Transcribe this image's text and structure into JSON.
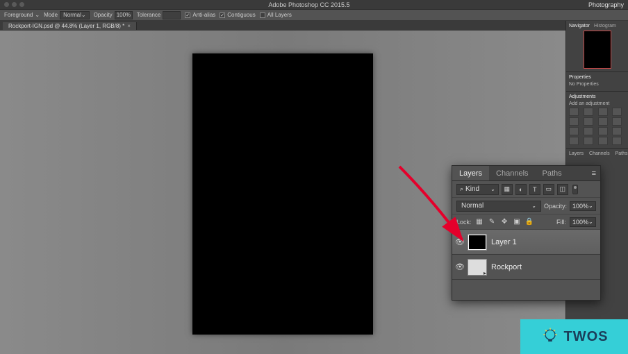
{
  "app": {
    "title": "Adobe Photoshop CC 2015.5",
    "workspace": "Photography"
  },
  "options": {
    "foreground_label": "Foreground",
    "mode_label": "Mode",
    "mode_value": "Normal",
    "opacity_label": "Opacity",
    "opacity_value": "100%",
    "tolerance_label": "Tolerance",
    "antialias_label": "Anti-alias",
    "contiguous_label": "Contiguous",
    "alllayers_label": "All Layers"
  },
  "tab": {
    "title": "Rockport-IGN.psd @ 44.8% (Layer 1, RGB/8) *"
  },
  "dock": {
    "navigator_tab": "Navigator",
    "histogram_tab": "Histogram",
    "properties_tab": "Properties",
    "properties_msg": "No Properties",
    "adjustments_tab": "Adjustments",
    "add_adjustment": "Add an adjustment",
    "layers_tab": "Layers",
    "channels_tab": "Channels",
    "paths_tab": "Paths",
    "kind": "Kind",
    "normal": "Normal",
    "opacity_label": "Opacity",
    "opacity_value": "100%",
    "fill_label": "Fill",
    "fill_value": "100%",
    "lock_label": "Lock"
  },
  "layers_panel": {
    "tabs": {
      "layers": "Layers",
      "channels": "Channels",
      "paths": "Paths"
    },
    "kind": "Kind",
    "blend_mode": "Normal",
    "opacity_label": "Opacity:",
    "opacity_value": "100%",
    "lock_label": "Lock:",
    "fill_label": "Fill:",
    "fill_value": "100%",
    "items": [
      {
        "name": "Layer 1",
        "visible": true,
        "selected": true,
        "thumb": "black"
      },
      {
        "name": "Rockport",
        "visible": true,
        "selected": false,
        "thumb": "smart"
      }
    ]
  },
  "watermark": {
    "text": "TWOS"
  }
}
